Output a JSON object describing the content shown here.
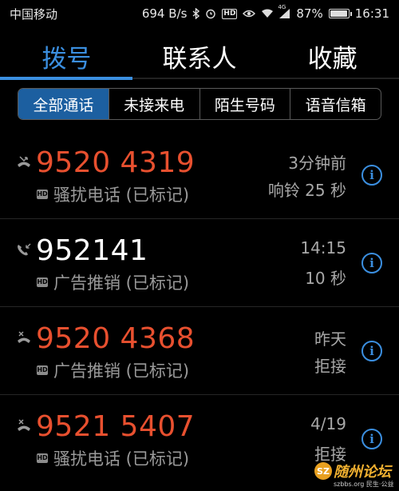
{
  "status_bar": {
    "carrier": "中国移动",
    "net_speed": "694 B/s",
    "hd_badge": "HD",
    "network_type": "4G",
    "battery_percent": "87%",
    "battery_level": 0.87,
    "time": "16:31"
  },
  "tabs": [
    {
      "label": "拨号",
      "active": true
    },
    {
      "label": "联系人",
      "active": false
    },
    {
      "label": "收藏",
      "active": false
    }
  ],
  "filters": [
    {
      "label": "全部通话",
      "active": true
    },
    {
      "label": "未接来电",
      "active": false
    },
    {
      "label": "陌生号码",
      "active": false
    },
    {
      "label": "语音信箱",
      "active": false
    }
  ],
  "calls": [
    {
      "number": "9520 4319",
      "type": "missed",
      "tag": "骚扰电话 (已标记)",
      "time": "3分钟前",
      "detail": "响铃 25 秒",
      "hd": "HD"
    },
    {
      "number": "952141",
      "type": "incoming",
      "tag": "广告推销 (已标记)",
      "time": "14:15",
      "detail": "10 秒",
      "hd": "HD"
    },
    {
      "number": "9520 4368",
      "type": "rejected",
      "tag": "广告推销 (已标记)",
      "time": "昨天",
      "detail": "拒接",
      "hd": "HD"
    },
    {
      "number": "9521 5407",
      "type": "rejected",
      "tag": "骚扰电话 (已标记)",
      "time": "4/19",
      "detail": "拒接",
      "hd": "HD"
    }
  ],
  "colors": {
    "accent": "#3b8fe0",
    "missed": "#e8502f",
    "secondary_text": "#a8a8a8"
  },
  "watermark": {
    "logo_text": "SZ",
    "title": "随州论坛",
    "subtitle": "szbbs.org 民生·公益"
  }
}
